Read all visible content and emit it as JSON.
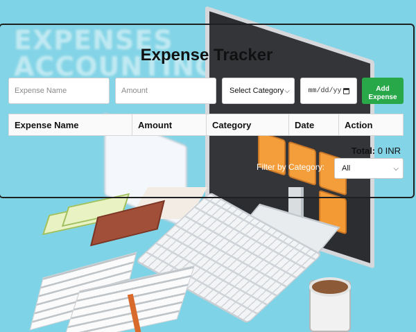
{
  "background": {
    "word_1": "EXPENSES",
    "word_2": "ACCOUNTING"
  },
  "app": {
    "title": "Expense Tracker",
    "form": {
      "name_placeholder": "Expense Name",
      "amount_placeholder": "Amount",
      "category_selected": "Select Category",
      "date_placeholder": "mm/dd/yy",
      "add_button": "Add\nExpense"
    },
    "table": {
      "headers": [
        "Expense Name",
        "Amount",
        "Category",
        "Date",
        "Action"
      ]
    },
    "total": {
      "label": "Total:",
      "value": "0 INR"
    },
    "filter": {
      "label": "Filter by Category:",
      "selected": "All"
    }
  },
  "colors": {
    "background": "#7fd3e6",
    "add_button": "#29a84a"
  },
  "icons": {
    "category_dropdown": "chevron-down-icon",
    "date_picker": "calendar-icon",
    "filter_dropdown": "chevron-down-icon"
  }
}
